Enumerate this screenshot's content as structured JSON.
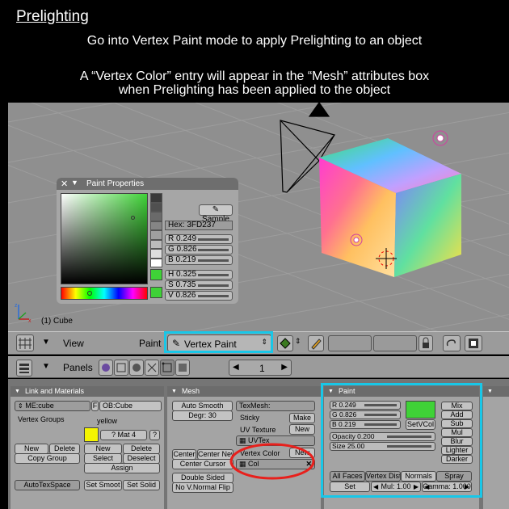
{
  "header": {
    "title": "Prelighting",
    "line1": "Go into Vertex Paint mode to apply Prelighting to an object",
    "line2": "A “Vertex Color” entry will appear in the “Mesh” attributes box",
    "line3": "when Prelighting has been applied to the object"
  },
  "viewport": {
    "object_label": "(1) Cube",
    "paint_properties": {
      "title": "Paint Properties",
      "sample_label": "Sample",
      "hex": "Hex: 3FD237",
      "r": "R 0.249",
      "g": "G 0.826",
      "b": "B 0.219",
      "h": "H 0.325",
      "s": "S 0.735",
      "v": "V 0.826",
      "color": "#3fd237"
    }
  },
  "toolbar": {
    "view_label": "View",
    "paint_label": "Paint",
    "mode_label": "Vertex Paint"
  },
  "buttons_header": {
    "panels_label": "Panels",
    "frame_value": "1"
  },
  "link_panel": {
    "title": "Link and Materials",
    "me_field": "ME:cube",
    "f_label": "F",
    "ob_field": "OB:Cube",
    "vertex_groups": "Vertex Groups",
    "material_name": "yellow",
    "material_index": "? Mat 4",
    "question": "?",
    "new1": "New",
    "delete1": "Delete",
    "copy_group": "Copy Group",
    "new2": "New",
    "delete2": "Delete",
    "select": "Select",
    "deselect": "Deselect",
    "assign": "Assign",
    "autotexspace": "AutoTexSpace",
    "set_smooth": "Set Smoot",
    "set_solid": "Set Solid"
  },
  "mesh_panel": {
    "title": "Mesh",
    "auto_smooth": "Auto Smooth",
    "degr": "Degr: 30",
    "texmesh": "TexMesh:",
    "sticky": "Sticky",
    "make": "Make",
    "uv_texture": "UV Texture",
    "new_uv": "New",
    "uvtex": "UVTex",
    "vertex_color": "Vertex Color",
    "new_vc": "New",
    "col": "Col",
    "center": "Center",
    "center_new": "Center New",
    "center_cursor": "Center Cursor",
    "double_sided": "Double Sided",
    "no_vnormal_flip": "No V.Normal Flip"
  },
  "paint_panel": {
    "title": "Paint",
    "r": "R 0.249",
    "g": "G 0.826",
    "b": "B 0.219",
    "set_vcol": "SetVCol",
    "opacity": "Opacity 0.200",
    "size": "Size 25.00",
    "modes": [
      "Mix",
      "Add",
      "Sub",
      "Mul",
      "Blur",
      "Lighter",
      "Darker"
    ],
    "all_faces": "All Faces",
    "vertex_dist": "Vertex Dist",
    "normals": "Normals",
    "spray": "Spray",
    "set": "Set",
    "mul": "Mul: 1.00",
    "gamma": "Gamma: 1.000",
    "color": "#3fd237"
  },
  "accent_color": "#18c7e8",
  "annotation_color": "#e8201c"
}
